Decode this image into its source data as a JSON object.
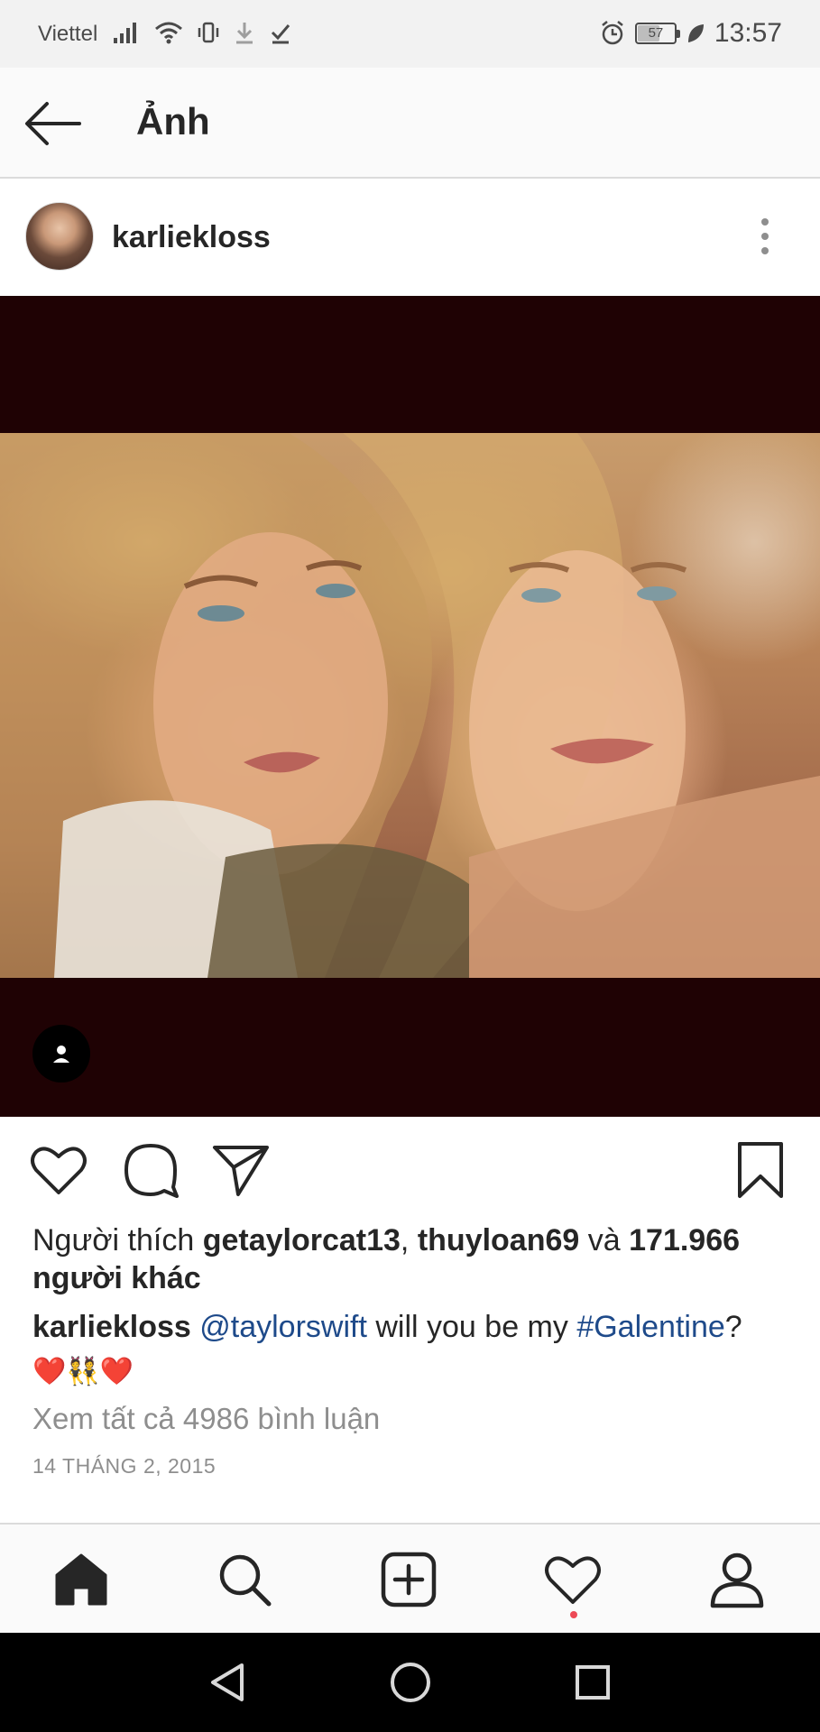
{
  "status_bar": {
    "carrier": "Viettel",
    "battery_level": "57",
    "battery_fraction": 0.57,
    "time": "13:57",
    "icons": [
      "signal-icon",
      "wifi-icon",
      "vibrate-icon",
      "download-icon",
      "check-icon",
      "alarm-icon",
      "battery-icon",
      "leaf-icon"
    ]
  },
  "header": {
    "title": "Ảnh",
    "back_icon": "arrow-left-icon"
  },
  "post": {
    "username": "karliekloss",
    "likes": {
      "prefix": "Người thích ",
      "user1": "getaylorcat13",
      "sep": ", ",
      "user2": "thuyloan69",
      "conj": " và ",
      "count": "171.966",
      "suffix": "người khác"
    },
    "caption": {
      "author": "karliekloss",
      "mention": "@taylorswift",
      "text": " will you be my ",
      "hashtag": "#Galentine",
      "end": "?",
      "emojis": "❤️👯❤️"
    },
    "view_comments": "Xem tất cả 4986 bình luận",
    "date": "14 THÁNG 2, 2015"
  },
  "actions": [
    "heart-icon",
    "comment-icon",
    "share-icon",
    "bookmark-icon"
  ],
  "bottom_nav": [
    "home-icon",
    "search-icon",
    "add-post-icon",
    "activity-icon",
    "profile-icon"
  ],
  "system_nav": [
    "back-triangle-icon",
    "home-circle-icon",
    "recents-square-icon"
  ]
}
